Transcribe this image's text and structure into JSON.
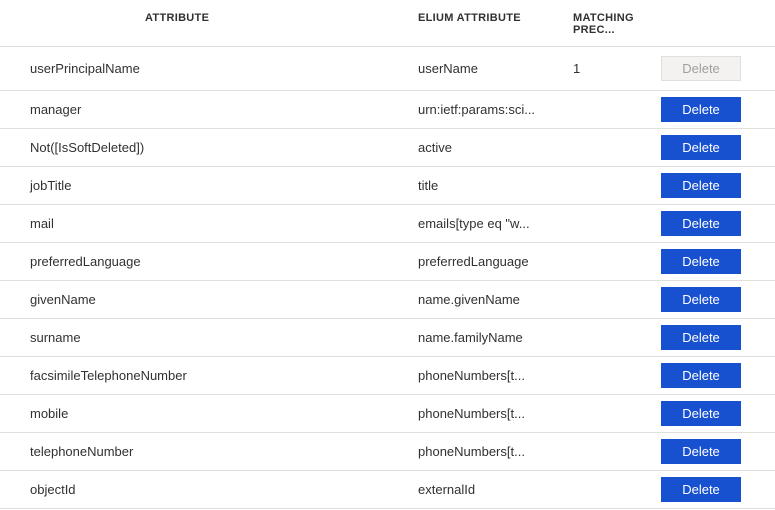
{
  "headers": {
    "attribute": "ATTRIBUTE",
    "elium": "ELIUM ATTRIBUTE",
    "precedence": "MATCHING PREC..."
  },
  "buttons": {
    "delete": "Delete"
  },
  "rows": [
    {
      "attribute": "userPrincipalName",
      "elium": "userName",
      "precedence": "1",
      "disabled": true
    },
    {
      "attribute": "manager",
      "elium": "urn:ietf:params:sci...",
      "precedence": "",
      "disabled": false
    },
    {
      "attribute": "Not([IsSoftDeleted])",
      "elium": "active",
      "precedence": "",
      "disabled": false
    },
    {
      "attribute": "jobTitle",
      "elium": "title",
      "precedence": "",
      "disabled": false
    },
    {
      "attribute": "mail",
      "elium": "emails[type eq \"w...",
      "precedence": "",
      "disabled": false
    },
    {
      "attribute": "preferredLanguage",
      "elium": "preferredLanguage",
      "precedence": "",
      "disabled": false
    },
    {
      "attribute": "givenName",
      "elium": "name.givenName",
      "precedence": "",
      "disabled": false
    },
    {
      "attribute": "surname",
      "elium": "name.familyName",
      "precedence": "",
      "disabled": false
    },
    {
      "attribute": "facsimileTelephoneNumber",
      "elium": "phoneNumbers[t...",
      "precedence": "",
      "disabled": false
    },
    {
      "attribute": "mobile",
      "elium": "phoneNumbers[t...",
      "precedence": "",
      "disabled": false
    },
    {
      "attribute": "telephoneNumber",
      "elium": "phoneNumbers[t...",
      "precedence": "",
      "disabled": false
    },
    {
      "attribute": "objectId",
      "elium": "externalId",
      "precedence": "",
      "disabled": false
    }
  ]
}
